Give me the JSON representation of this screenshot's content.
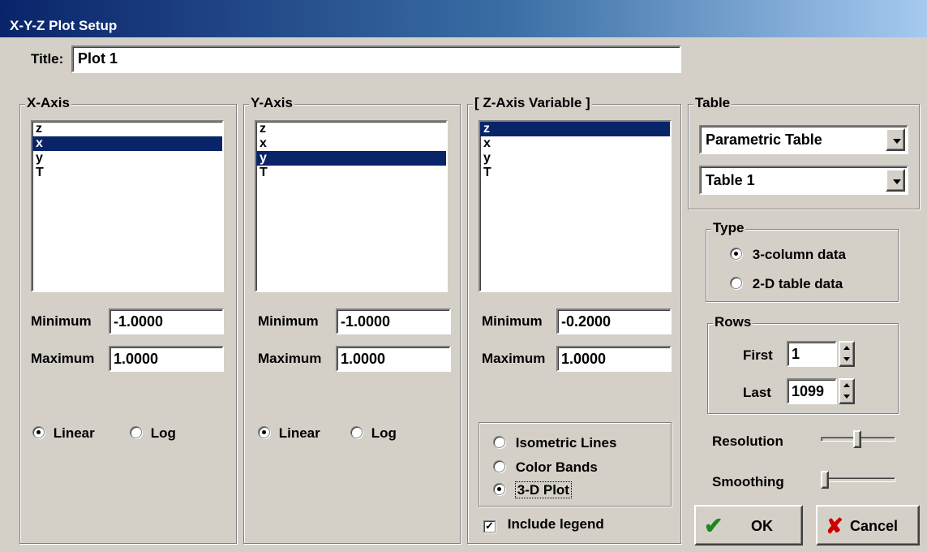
{
  "window": {
    "title": "X-Y-Z Plot Setup"
  },
  "title_field": {
    "label": "Title:",
    "value": "Plot 1"
  },
  "x_axis": {
    "legend": "X-Axis",
    "variables": [
      "z",
      "x",
      "y",
      "T"
    ],
    "selected": "x",
    "minimum_label": "Minimum",
    "minimum": "-1.0000",
    "maximum_label": "Maximum",
    "maximum": "1.0000",
    "scale_linear": "Linear",
    "scale_log": "Log",
    "scale_selected": "Linear"
  },
  "y_axis": {
    "legend": "Y-Axis",
    "variables": [
      "z",
      "x",
      "y",
      "T"
    ],
    "selected": "y",
    "minimum_label": "Minimum",
    "minimum": "-1.0000",
    "maximum_label": "Maximum",
    "maximum": "1.0000",
    "scale_linear": "Linear",
    "scale_log": "Log",
    "scale_selected": "Linear"
  },
  "z_axis": {
    "legend": "[ Z-Axis Variable ]",
    "variables": [
      "z",
      "x",
      "y",
      "T"
    ],
    "selected": "z",
    "minimum_label": "Minimum",
    "minimum": "-0.2000",
    "maximum_label": "Maximum",
    "maximum": "1.0000",
    "plot_styles": [
      "Isometric Lines",
      "Color Bands",
      "3-D Plot"
    ],
    "plot_style_selected": "3-D Plot",
    "include_legend_label": "Include legend",
    "include_legend": true
  },
  "table": {
    "legend": "Table",
    "table_type": "Parametric Table",
    "table_name": "Table 1"
  },
  "type": {
    "legend": "Type",
    "options": [
      "3-column data",
      "2-D table data"
    ],
    "selected": "3-column data"
  },
  "rows": {
    "legend": "Rows",
    "first_label": "First",
    "first": "1",
    "last_label": "Last",
    "last": "1099"
  },
  "resolution": {
    "label": "Resolution",
    "level": 0.5
  },
  "smoothing": {
    "label": "Smoothing",
    "level": 0.0
  },
  "buttons": {
    "ok": "OK",
    "cancel": "Cancel"
  },
  "colors": {
    "selection": "#0a246a",
    "ok_check": "#1a8a1a",
    "cancel_x": "#cc0000"
  }
}
